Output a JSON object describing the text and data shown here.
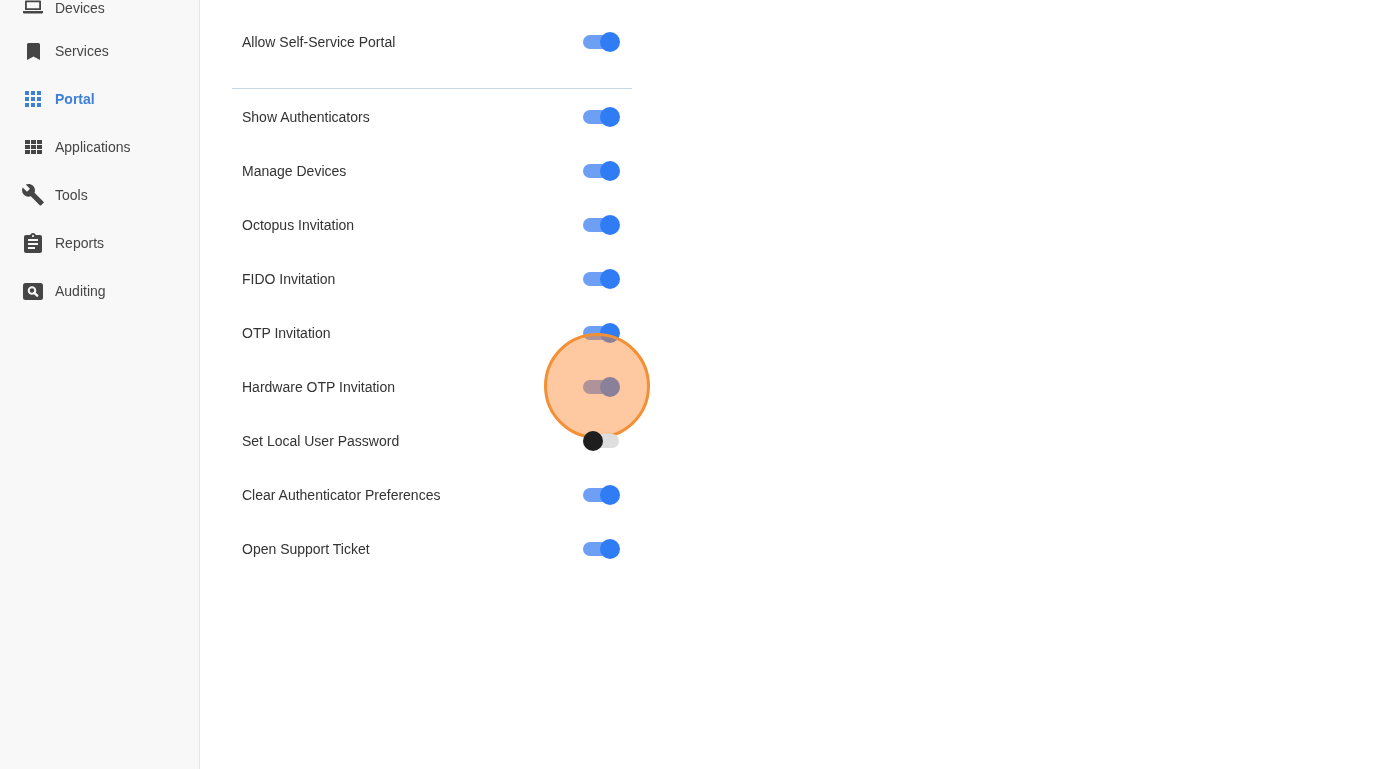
{
  "sidebar": {
    "items": [
      {
        "label": "Devices",
        "selected": false
      },
      {
        "label": "Services",
        "selected": false
      },
      {
        "label": "Portal",
        "selected": true
      },
      {
        "label": "Applications",
        "selected": false
      },
      {
        "label": "Tools",
        "selected": false
      },
      {
        "label": "Reports",
        "selected": false
      },
      {
        "label": "Auditing",
        "selected": false
      }
    ]
  },
  "portal_setting": {
    "label": "Allow Self-Service Portal",
    "on": true
  },
  "options": [
    {
      "label": "Show Authenticators",
      "on": true,
      "highlighted": false
    },
    {
      "label": "Manage Devices",
      "on": true,
      "highlighted": false
    },
    {
      "label": "Octopus Invitation",
      "on": true,
      "highlighted": false
    },
    {
      "label": "FIDO Invitation",
      "on": true,
      "highlighted": false
    },
    {
      "label": "OTP Invitation",
      "on": true,
      "highlighted": false
    },
    {
      "label": "Hardware OTP Invitation",
      "on": true,
      "highlighted": true
    },
    {
      "label": "Set Local User Password",
      "on": false,
      "highlighted": false
    },
    {
      "label": "Clear Authenticator Preferences",
      "on": true,
      "highlighted": false
    },
    {
      "label": "Open Support Ticket",
      "on": true,
      "highlighted": false
    }
  ]
}
